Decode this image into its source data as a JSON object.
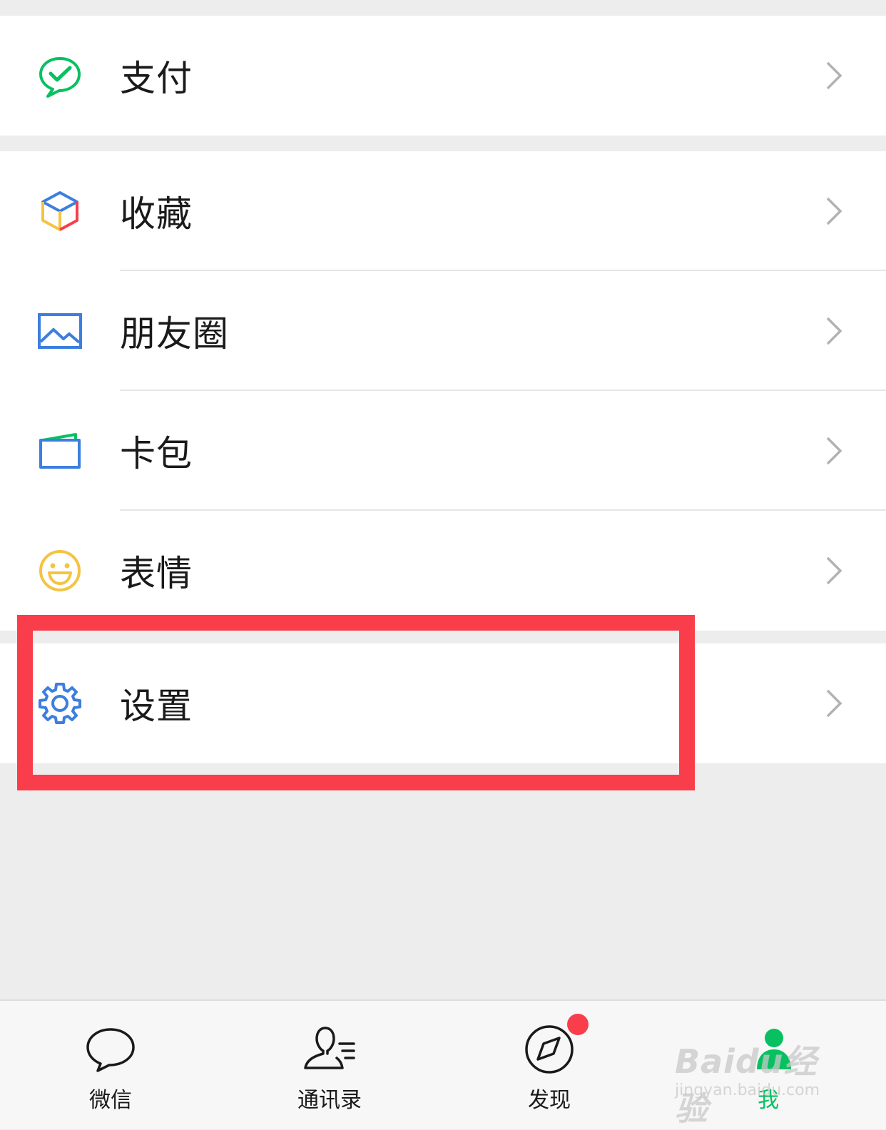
{
  "groups": [
    {
      "items": [
        {
          "label": "支付",
          "icon": "wechat-pay-icon"
        }
      ]
    },
    {
      "items": [
        {
          "label": "收藏",
          "icon": "favorites-cube-icon"
        },
        {
          "label": "朋友圈",
          "icon": "moments-image-icon"
        },
        {
          "label": "卡包",
          "icon": "card-wallet-icon"
        },
        {
          "label": "表情",
          "icon": "smiley-face-icon"
        }
      ]
    },
    {
      "items": [
        {
          "label": "设置",
          "icon": "gear-icon"
        }
      ]
    }
  ],
  "tabbar": {
    "tabs": [
      {
        "label": "微信",
        "icon": "chat-bubble-icon",
        "active": false
      },
      {
        "label": "通讯录",
        "icon": "contacts-icon",
        "active": false
      },
      {
        "label": "发现",
        "icon": "compass-icon",
        "active": false,
        "badge": true
      },
      {
        "label": "我",
        "icon": "profile-icon",
        "active": true
      }
    ]
  },
  "watermark": {
    "logo": "Baidu经验",
    "url": "jingyan.baidu.com"
  },
  "colors": {
    "accent_green": "#07c160",
    "highlight_red": "#fa3d4b",
    "badge_red": "#fa3d4b",
    "icon_blue": "#3d7ede",
    "icon_yellow": "#f5c342",
    "background": "#ededed"
  }
}
